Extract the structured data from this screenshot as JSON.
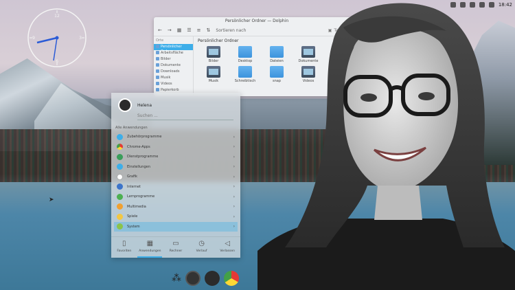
{
  "top_panel": {
    "time": "18:42"
  },
  "clock_widget": {
    "numbers": [
      "12",
      "3",
      "6",
      "9"
    ]
  },
  "dolphin": {
    "title": "Persönlicher Ordner — Dolphin",
    "sort_label": "Sortieren nach",
    "split_label": "Teilen",
    "places_header": "Orte",
    "places": [
      "Persönlicher Ordner",
      "Arbeitsfläche",
      "Bilder",
      "Dokumente",
      "Downloads",
      "Musik",
      "Videos",
      "Papierkorb"
    ],
    "breadcrumb": "Persönlicher Ordner",
    "files": [
      "Bilder",
      "Desktop",
      "Dateien",
      "Dokumente",
      "",
      "Musik",
      "Schreibtisch",
      "snap",
      "Videos"
    ]
  },
  "launcher": {
    "user": "Helena",
    "search_placeholder": "Suchen ...",
    "section": "Alle Anwendungen",
    "apps": [
      {
        "label": "Zubehörprogramme",
        "color": "#3daee9"
      },
      {
        "label": "Chrome-Apps",
        "color": "#e8a33b"
      },
      {
        "label": "Dienstprogramme",
        "color": "#3a9d5a"
      },
      {
        "label": "Einstellungen",
        "color": "#3daee9"
      },
      {
        "label": "Grafik",
        "color": "#ffffff"
      },
      {
        "label": "Internet",
        "color": "#3b74c9"
      },
      {
        "label": "Lernprogramme",
        "color": "#4caf50"
      },
      {
        "label": "Multimedia",
        "color": "#f0a030"
      },
      {
        "label": "Spiele",
        "color": "#f2c744"
      },
      {
        "label": "System",
        "color": "#8bc34a"
      }
    ],
    "tabs": [
      "Favoriten",
      "Anwendungen",
      "Rechner",
      "Verlauf",
      "Verlassen"
    ]
  }
}
